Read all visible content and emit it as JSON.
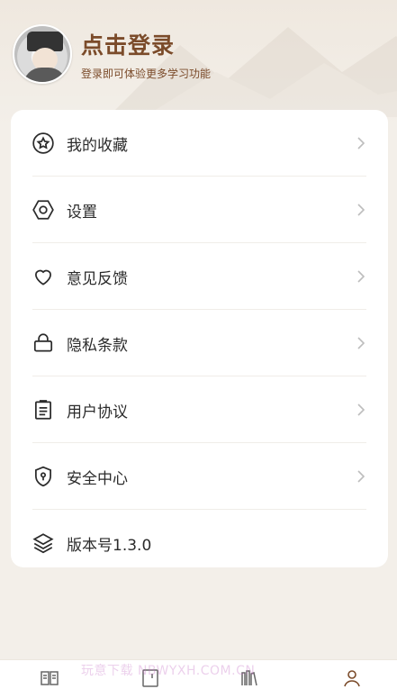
{
  "profile": {
    "title": "点击登录",
    "subtitle": "登录即可体验更多学习功能"
  },
  "menu": [
    {
      "label": "我的收藏",
      "icon": "star-circle-icon"
    },
    {
      "label": "设置",
      "icon": "hexagon-settings-icon"
    },
    {
      "label": "意见反馈",
      "icon": "heart-icon"
    },
    {
      "label": "隐私条款",
      "icon": "lock-icon"
    },
    {
      "label": "用户协议",
      "icon": "clipboard-icon"
    },
    {
      "label": "安全中心",
      "icon": "shield-keyhole-icon"
    },
    {
      "label": "版本号1.3.0",
      "icon": "layers-icon"
    }
  ],
  "watermark": "玩意下载 NBWYXH.COM.CN",
  "tabbar": [
    "book-icon",
    "notebook-icon",
    "library-icon",
    "person-icon"
  ],
  "colors": {
    "accent": "#7b4b2a",
    "background": "#f3efe9",
    "card": "#ffffff"
  }
}
